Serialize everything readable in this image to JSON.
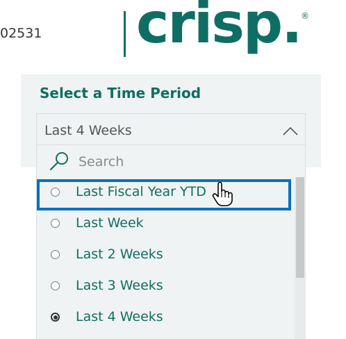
{
  "header": {
    "id_text": "02531",
    "logo_text": "crisp.",
    "logo_registered": "®"
  },
  "filter": {
    "title": "Select a Time Period",
    "selected_value": "Last 4 Weeks",
    "search_placeholder": "Search",
    "options": [
      {
        "label": "Last Fiscal Year YTD",
        "checked": false,
        "hovered": true
      },
      {
        "label": "Last Week",
        "checked": false,
        "hovered": false
      },
      {
        "label": "Last 2 Weeks",
        "checked": false,
        "hovered": false
      },
      {
        "label": "Last 3 Weeks",
        "checked": false,
        "hovered": false
      },
      {
        "label": "Last 4 Weeks",
        "checked": true,
        "hovered": false
      }
    ]
  },
  "colors": {
    "brand": "#0f6e63",
    "focus_outline": "#0a70c0",
    "panel_bg": "#f0f3f3"
  },
  "icons": {
    "dropdown": "chevron-up-icon",
    "search": "search-icon",
    "cursor": "hand-pointer-icon"
  }
}
